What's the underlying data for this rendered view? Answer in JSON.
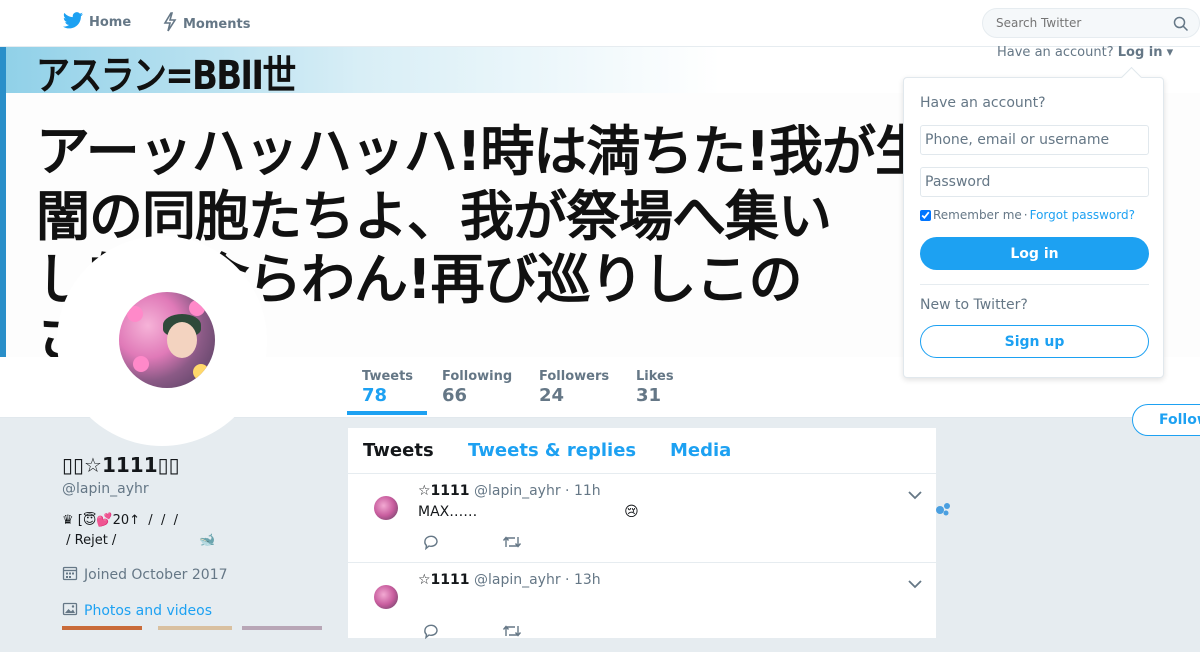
{
  "nav": {
    "home_label": "Home",
    "moments_label": "Moments",
    "search_placeholder": "Search Twitter"
  },
  "banner": {
    "line1": "アスラン=BBII世",
    "line2": "アーッハッハッハ!時は満ちた!我が生誕祭",
    "line3": "闇の同胞たちよ、我が祭場へ集い",
    "line4": "し魅せ食らわん!再び巡りしこの",
    "line5": "さ"
  },
  "account_link": {
    "prefix": "Have an account?",
    "login": "Log in"
  },
  "login_panel": {
    "title": "Have an account?",
    "username_placeholder": "Phone, email or username",
    "password_placeholder": "Password",
    "remember": "Remember me",
    "forgot": "Forgot password?",
    "login_button": "Log in",
    "new_prompt": "New to Twitter?",
    "signup_button": "Sign up"
  },
  "stats": [
    {
      "label": "Tweets",
      "value": "78"
    },
    {
      "label": "Following",
      "value": "66"
    },
    {
      "label": "Followers",
      "value": "24"
    },
    {
      "label": "Likes",
      "value": "31"
    }
  ],
  "follow_button": "Follow",
  "profile": {
    "name": "▯▯☆1111▯▯",
    "handle": "@lapin_ayhr",
    "bio_line1": "♛ [😇💕20↑  /  /  /",
    "bio_line2": " / Rejet /                    🐋",
    "joined": "Joined October 2017",
    "photos_link": "Photos and videos"
  },
  "timeline": {
    "tabs": [
      "Tweets",
      "Tweets & replies",
      "Media"
    ],
    "tweets": [
      {
        "name": "☆1111",
        "handle": "@lapin_ayhr",
        "time": "· 11h",
        "text": "MAX……                                 😢"
      },
      {
        "name": "☆1111",
        "handle": "@lapin_ayhr",
        "time": "· 13h",
        "text": ""
      }
    ]
  },
  "colors": {
    "accent": "#1da1f2",
    "secondary_text": "#657786",
    "background": "#e6ecf0"
  }
}
